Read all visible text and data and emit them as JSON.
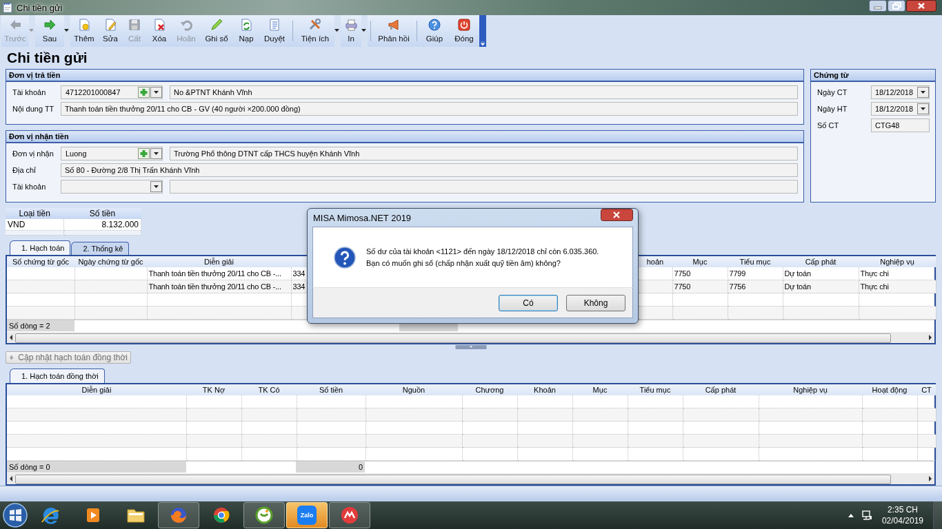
{
  "window": {
    "title": "Chi tiền gửi"
  },
  "toolbar": {
    "groups": [
      [
        {
          "label": "Trước",
          "disabled": true,
          "dropdown": true
        },
        {
          "label": "Sau",
          "disabled": false,
          "dropdown": true
        },
        {
          "label": "Thêm",
          "disabled": false,
          "dropdown": false
        },
        {
          "label": "Sửa",
          "disabled": false,
          "dropdown": false
        },
        {
          "label": "Cất",
          "disabled": true,
          "dropdown": false
        },
        {
          "label": "Xóa",
          "disabled": false,
          "dropdown": false
        },
        {
          "label": "Hoãn",
          "disabled": true,
          "dropdown": false
        },
        {
          "label": "Ghi sổ",
          "disabled": false,
          "dropdown": false
        },
        {
          "label": "Nạp",
          "disabled": false,
          "dropdown": false
        },
        {
          "label": "Duyệt",
          "disabled": false,
          "dropdown": false
        }
      ],
      [
        {
          "label": "Tiện ích",
          "disabled": false,
          "dropdown": true
        },
        {
          "label": "In",
          "disabled": false,
          "dropdown": true
        }
      ],
      [
        {
          "label": "Phản hồi",
          "disabled": false,
          "dropdown": false
        }
      ],
      [
        {
          "label": "Giúp",
          "disabled": false,
          "dropdown": false
        },
        {
          "label": "Đóng",
          "disabled": false,
          "dropdown": false
        }
      ]
    ]
  },
  "heading": "Chi tiền gửi",
  "payer": {
    "title": "Đơn vị trả tiền",
    "fields": [
      {
        "kind": "combo",
        "label": "Tài khoản",
        "value": "4712201000847",
        "add": true,
        "detail": "No &PTNT Khánh Vĩnh"
      },
      {
        "kind": "text",
        "label": "Nội dung TT",
        "value": "Thanh toán tiền thưởng 20/11 cho CB - GV (40 người ×200.000 đồng)"
      }
    ]
  },
  "payee": {
    "title": "Đơn vị nhận tiền",
    "fields": [
      {
        "kind": "combo",
        "label": "Đơn vị nhận",
        "value": "Luong",
        "add": true,
        "detail": "Trường Phổ thông DTNT cấp THCS huyện Khánh Vĩnh"
      },
      {
        "kind": "text",
        "label": "Địa chỉ",
        "value": "Số 80 - Đường 2/8 Thị Trấn Khánh Vĩnh"
      },
      {
        "kind": "combo",
        "label": "Tài khoản",
        "add": false
      }
    ]
  },
  "voucher": {
    "title": "Chứng từ",
    "fields": [
      {
        "kind": "date",
        "label": "Ngày CT",
        "value": "18/12/2018"
      },
      {
        "kind": "date",
        "label": "Ngày HT",
        "value": "18/12/2018"
      },
      {
        "kind": "text",
        "label": "Số CT",
        "value": "CTG48"
      }
    ]
  },
  "currency": {
    "columns": [
      "Loại tiền",
      "Số tiền"
    ],
    "rows": [
      [
        "VND",
        "8.132.000"
      ]
    ]
  },
  "tabs": [
    {
      "label": "1. Hạch toán",
      "selected": true
    },
    {
      "label": "2. Thống kê",
      "selected": false
    }
  ],
  "table": {
    "columns": [
      "Số chứng từ gốc",
      "Ngày chứng từ gốc",
      "Diễn giải",
      null,
      "hoản",
      "Mục",
      "Tiểu mục",
      "Cấp phát",
      "Nghiệp vụ"
    ],
    "rows": [
      [
        "",
        "",
        "Thanh toán tiền thưởng 20/11 cho CB -...",
        "334",
        "",
        "7750",
        "7799",
        "Dự toán",
        "Thực chi"
      ],
      [
        "",
        "",
        "Thanh toán tiền thưởng 20/11 cho CB -...",
        "334",
        "",
        "7750",
        "7756",
        "Dự toán",
        "Thực chi"
      ]
    ],
    "footer": {
      "row_count": "Số dòng = 2"
    }
  },
  "update_button": {
    "label": "Cập nhật hạch toán đồng thời",
    "disabled": true
  },
  "tabs_2": [
    {
      "label": "1. Hạch toán đồng thời",
      "selected": true
    }
  ],
  "table_2": {
    "columns": [
      "Diễn giải",
      "TK Nợ",
      "TK Có",
      "Số tiền",
      "Nguồn",
      "Chương",
      "Khoản",
      "Mục",
      "Tiểu mục",
      "Cấp phát",
      "Nghiệp vụ",
      "Hoạt động",
      "CT"
    ],
    "footer": {
      "row_count": "Số dòng = 0",
      "total": "0"
    }
  },
  "dialog": {
    "title": "MISA Mimosa.NET 2019",
    "message": [
      "Số dư của tài khoản <1121> đến ngày 18/12/2018  chỉ còn 6.035.360.",
      "Bạn có muốn ghi sổ (chấp nhận xuất quỹ tiền âm) không?"
    ],
    "buttons": [
      {
        "label": "Có",
        "selected": true
      },
      {
        "label": "Không",
        "selected": false
      }
    ]
  },
  "taskbar": {
    "apps": [
      {
        "running": false,
        "selected": false
      },
      {
        "running": false,
        "selected": false
      },
      {
        "running": false,
        "selected": false
      },
      {
        "running": true,
        "selected": false
      },
      {
        "running": false,
        "selected": false
      },
      {
        "running": true,
        "selected": false
      },
      {
        "running": true,
        "selected": true,
        "label": "Zalo"
      },
      {
        "running": true,
        "selected": false
      }
    ],
    "time": "2:35 CH",
    "date": "02/04/2019"
  }
}
